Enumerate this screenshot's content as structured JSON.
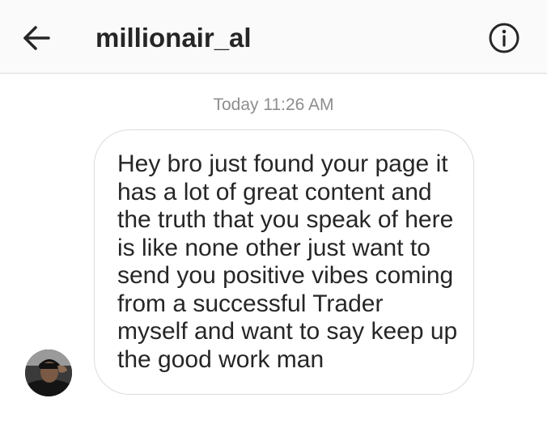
{
  "header": {
    "title": "millionair_al",
    "back_icon": "arrow-left-icon",
    "info_icon": "info-circle-icon"
  },
  "thread": {
    "timestamp": "Today 11:26 AM",
    "messages": [
      {
        "sender": "millionair_al",
        "text": "Hey bro just found your page it\nhas a lot of great content and\nthe truth that you speak of here\nis like none other just want to\nsend you positive vibes coming\nfrom a  successful Trader\nmyself and want to say keep up\nthe good work man"
      }
    ]
  }
}
